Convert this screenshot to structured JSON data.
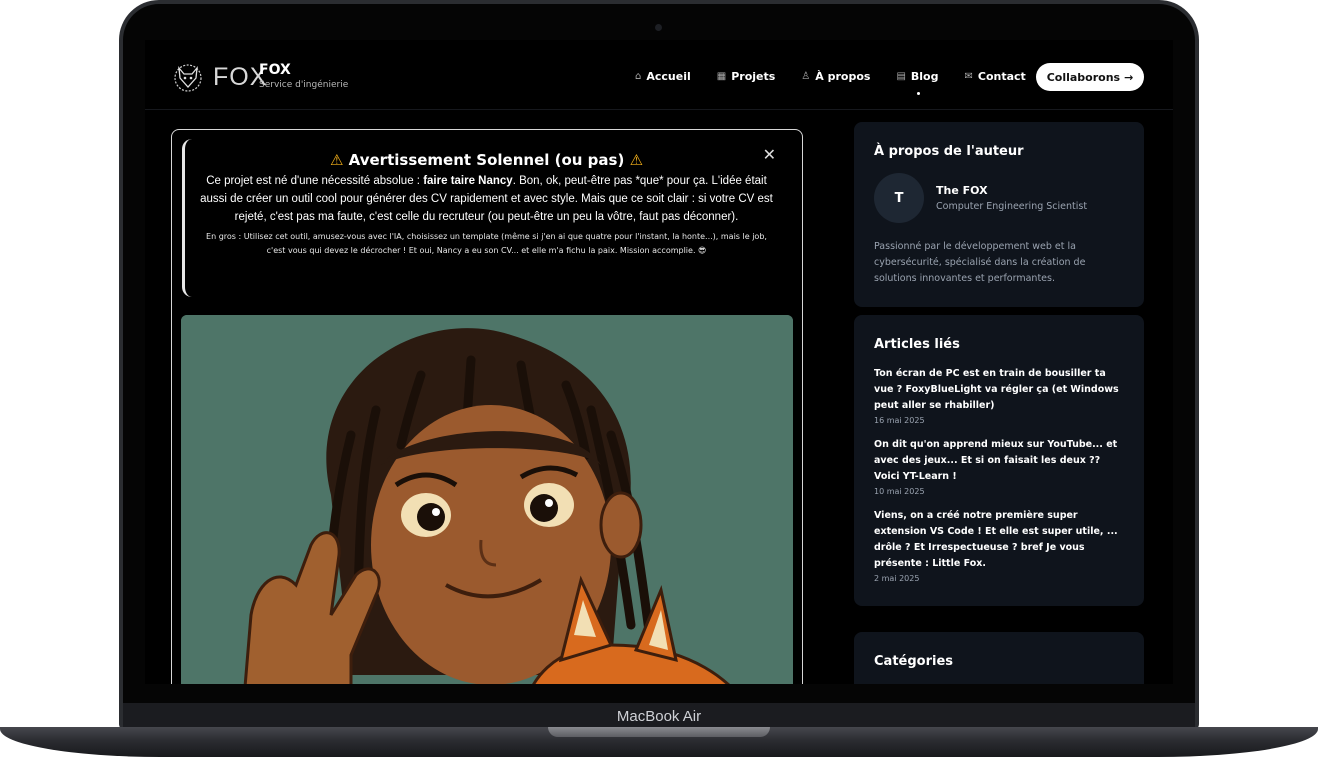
{
  "device": {
    "label": "MacBook Air"
  },
  "nav": {
    "logo_text": "FOX",
    "brand_name": "FOX",
    "brand_tagline": "Service d'ingénierie",
    "items": [
      {
        "label": "Accueil",
        "icon": "home-icon",
        "glyph": "⌂"
      },
      {
        "label": "Projets",
        "icon": "grid-icon",
        "glyph": "▦"
      },
      {
        "label": "À propos",
        "icon": "user-icon",
        "glyph": "♙"
      },
      {
        "label": "Blog",
        "icon": "book-icon",
        "glyph": "▤"
      },
      {
        "label": "Contact",
        "icon": "mail-icon",
        "glyph": "✉"
      }
    ],
    "active": "Blog",
    "cta_label": "Collaborons",
    "cta_arrow": "→"
  },
  "alert": {
    "title": "Avertissement Solennel (ou pas)",
    "warning_glyph": "⚠",
    "text_before": "Ce projet est né d'une nécessité absolue : ",
    "text_bold": "faire taire Nancy",
    "text_after": ". Bon, ok, peut-être pas *que* pour ça. L'idée était aussi de créer un outil cool pour générer des CV rapidement et avec style. Mais que ce soit clair : si votre CV est rejeté, c'est pas ma faute, c'est celle du recruteur (ou peut-être un peu la vôtre, faut pas déconner).",
    "small_text": "En gros : Utilisez cet outil, amusez-vous avec l'IA, choisissez un template (même si j'en ai que quatre pour l'instant, la honte...), mais le job, c'est vous qui devez le décrocher ! Et oui, Nancy a eu son CV... et elle m'a fichu la paix. Mission accomplie. 😎",
    "close_glyph": "✕"
  },
  "author": {
    "heading": "À propos de l'auteur",
    "initial": "T",
    "name": "The FOX",
    "role": "Computer Engineering Scientist",
    "bio": "Passionné par le développement web et la cybersécurité, spécialisé dans la création de solutions innovantes et performantes."
  },
  "related": {
    "heading": "Articles liés",
    "articles": [
      {
        "title": "Ton écran de PC est en train de bousiller ta vue ? FoxyBlueLight va régler ça (et Windows peut aller se rhabiller)",
        "date": "16 mai 2025"
      },
      {
        "title": "On dit qu'on apprend mieux sur YouTube... et avec des jeux... Et si on faisait les deux ?? Voici YT-Learn !",
        "date": "10 mai 2025"
      },
      {
        "title": "Viens, on a créé notre première super extension VS Code ! Et elle est super utile, ... drôle ? Et Irrespectueuse ? bref Je vous présente : Little Fox.",
        "date": "2 mai 2025"
      }
    ]
  },
  "categories": {
    "heading": "Catégories"
  },
  "colors": {
    "accent_warning": "#f6b21a",
    "card_bg": "#0f141c",
    "page_bg": "#000000"
  }
}
